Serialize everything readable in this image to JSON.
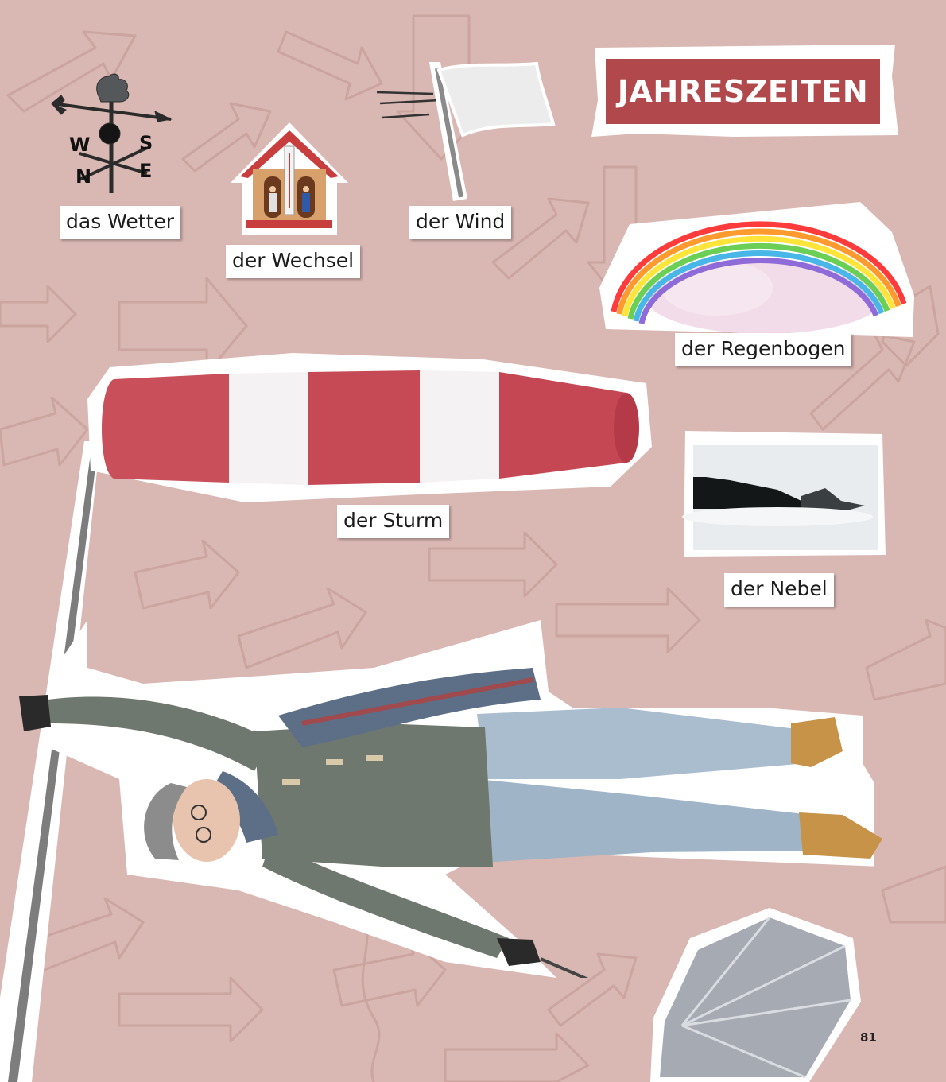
{
  "title": "JAHRESZEITEN",
  "page_number": "81",
  "words": {
    "wetter": "das Wetter",
    "wechsel": "der Wechsel",
    "wind": "der Wind",
    "regenbogen": "der Regenbogen",
    "sturm": "der Sturm",
    "nebel": "der Nebel"
  },
  "weathervane_letters": {
    "west": "W",
    "south": "S",
    "east": "E",
    "north": "N"
  },
  "colors": {
    "background": "#d9b7b2",
    "title_bg": "#b0484c",
    "windsock_red": "#c9505a",
    "windsock_white": "#f4f2f2"
  }
}
